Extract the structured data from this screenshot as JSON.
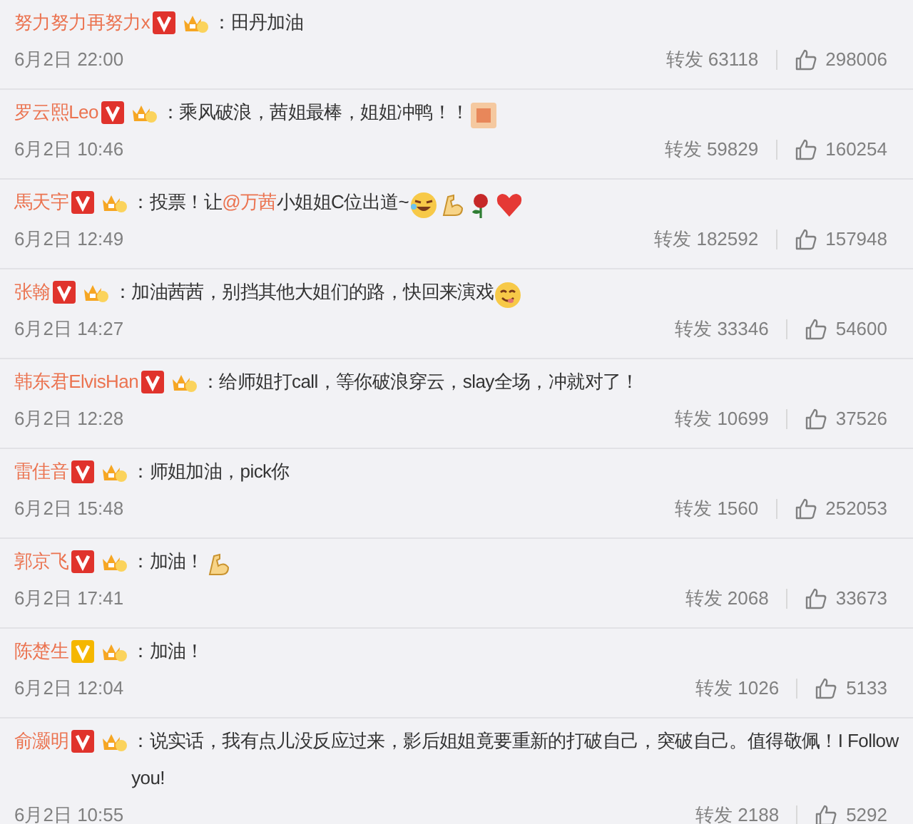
{
  "comments": [
    {
      "name": "努力努力再努力x",
      "badge": {
        "color": "#e0332c"
      },
      "content": [
        {
          "kind": "text",
          "text": "：田丹加油"
        }
      ],
      "time": "6月2日 22:00",
      "repost_label": "转发",
      "reposts": "63118",
      "likes": "298006"
    },
    {
      "name": "罗云熙Leo",
      "badge": {
        "color": "#e0332c"
      },
      "content": [
        {
          "kind": "text",
          "text": "：乘风破浪，茜姐最棒，姐姐冲鸭！！"
        },
        {
          "kind": "stamp"
        }
      ],
      "time": "6月2日 10:46",
      "repost_label": "转发",
      "reposts": "59829",
      "likes": "160254"
    },
    {
      "name": "馬天宇",
      "badge": {
        "color": "#e0332c"
      },
      "content": [
        {
          "kind": "text",
          "text": "：投票！让"
        },
        {
          "kind": "mention",
          "text": "@万茜"
        },
        {
          "kind": "text",
          "text": " 小姐姐C位出道~"
        },
        {
          "kind": "laugh"
        },
        {
          "kind": "muscle"
        },
        {
          "kind": "rose"
        },
        {
          "kind": "heart"
        }
      ],
      "time": "6月2日 12:49",
      "repost_label": "转发",
      "reposts": "182592",
      "likes": "157948"
    },
    {
      "name": "张翰",
      "badge": {
        "color": "#e0332c"
      },
      "content": [
        {
          "kind": "text",
          "text": "：加油茜茜，别挡其他大姐们的路，快回来演戏"
        },
        {
          "kind": "yum"
        }
      ],
      "time": "6月2日 14:27",
      "repost_label": "转发",
      "reposts": "33346",
      "likes": "54600"
    },
    {
      "name": "韩东君ElvisHan",
      "badge": {
        "color": "#e0332c"
      },
      "content": [
        {
          "kind": "text",
          "text": "：给师姐打call，等你破浪穿云，slay全场，冲就对了！"
        }
      ],
      "time": "6月2日 12:28",
      "repost_label": "转发",
      "reposts": "10699",
      "likes": "37526"
    },
    {
      "name": "雷佳音",
      "badge": {
        "color": "#e0332c"
      },
      "content": [
        {
          "kind": "text",
          "text": "：师姐加油，pick你"
        }
      ],
      "time": "6月2日 15:48",
      "repost_label": "转发",
      "reposts": "1560",
      "likes": "252053"
    },
    {
      "name": "郭京飞",
      "badge": {
        "color": "#e0332c"
      },
      "content": [
        {
          "kind": "text",
          "text": "：加油！"
        },
        {
          "kind": "muscle"
        }
      ],
      "time": "6月2日 17:41",
      "repost_label": "转发",
      "reposts": "2068",
      "likes": "33673"
    },
    {
      "name": "陈楚生",
      "badge": {
        "color": "#f5b700"
      },
      "content": [
        {
          "kind": "text",
          "text": "：加油！"
        }
      ],
      "time": "6月2日 12:04",
      "repost_label": "转发",
      "reposts": "1026",
      "likes": "5133"
    },
    {
      "name": "俞灏明",
      "badge": {
        "color": "#e0332c"
      },
      "content": [
        {
          "kind": "text",
          "text": "：说实话，我有点儿没反应过来，影后姐姐竟要重新的打破自己，突破自己。值得敬佩！I Follow you!"
        }
      ],
      "time": "6月2日 10:55",
      "repost_label": "转发",
      "reposts": "2188",
      "likes": "5292"
    }
  ]
}
